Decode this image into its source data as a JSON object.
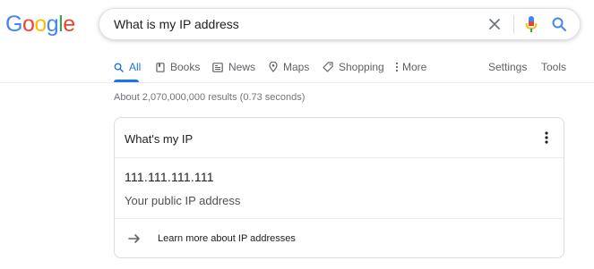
{
  "logo": {
    "letters": [
      "G",
      "o",
      "o",
      "g",
      "l",
      "e"
    ],
    "colors": [
      "#4285f4",
      "#ea4335",
      "#fbbc05",
      "#4285f4",
      "#34a853",
      "#ea4335"
    ]
  },
  "search": {
    "query": "What is my IP address"
  },
  "tabs": [
    {
      "label": "All",
      "icon": "search-icon",
      "active": true
    },
    {
      "label": "Books",
      "icon": "book-icon"
    },
    {
      "label": "News",
      "icon": "news-icon"
    },
    {
      "label": "Maps",
      "icon": "map-pin-icon"
    },
    {
      "label": "Shopping",
      "icon": "tag-icon"
    },
    {
      "label": "More",
      "icon": "more-vert-icon"
    }
  ],
  "tools": {
    "settings": "Settings",
    "tools": "Tools"
  },
  "result_stats": "About 2,070,000,000 results (0.73 seconds)",
  "ip_card": {
    "title": "What's my IP",
    "ip": "111.111.111.111",
    "caption": "Your public IP address",
    "footer_link": "Learn more about IP addresses"
  },
  "colors": {
    "accent": "#1a73e8",
    "muted": "#5f6368",
    "border": "#dadce0"
  }
}
